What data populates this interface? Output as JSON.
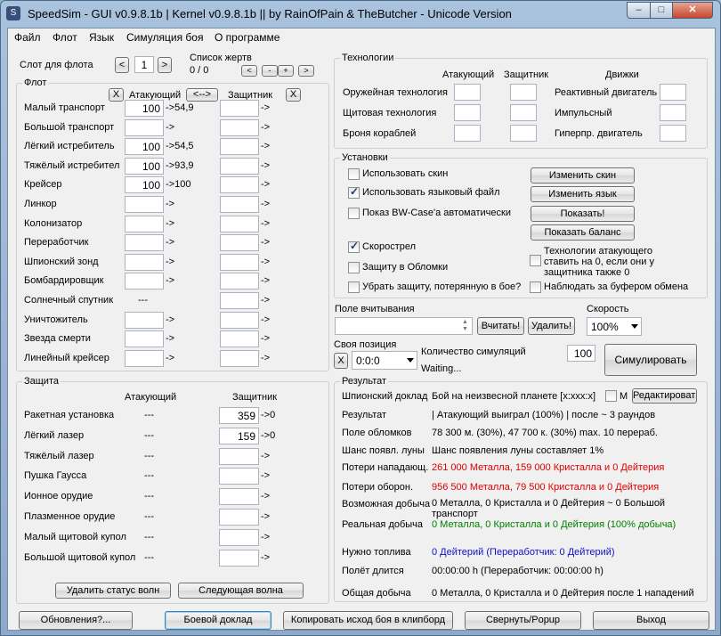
{
  "window": {
    "title": "SpeedSim - GUI v0.9.8.1b | Kernel v0.9.8.1b  ||  by RainOfPain & TheButcher - Unicode Version",
    "min": "‒",
    "max": "□",
    "close": "✕"
  },
  "menu": [
    "Файл",
    "Флот",
    "Язык",
    "Симуляция боя",
    "О программе"
  ],
  "slot": {
    "label": "Слот для флота",
    "value": "1",
    "prev": "<",
    "next": ">"
  },
  "victims": {
    "label": "Список жертв",
    "count": "0 / 0",
    "b1": "<",
    "b2": "-",
    "b3": "+",
    "b4": ">"
  },
  "fleet": {
    "legend": "Флот",
    "attacker": "Атакующий",
    "defender": "Защитник",
    "swap": "<-->",
    "clear": "X",
    "rows": [
      {
        "name": "Малый транспорт",
        "att": "100",
        "loss": "->54,9",
        "def": "",
        "dloss": "->"
      },
      {
        "name": "Большой транспорт",
        "att": "",
        "loss": "->",
        "def": "",
        "dloss": "->"
      },
      {
        "name": "Лёгкий истребитель",
        "att": "100",
        "loss": "->54,5",
        "def": "",
        "dloss": "->"
      },
      {
        "name": "Тяжёлый истребител",
        "att": "100",
        "loss": "->93,9",
        "def": "",
        "dloss": "->"
      },
      {
        "name": "Крейсер",
        "att": "100",
        "loss": "->100",
        "def": "",
        "dloss": "->"
      },
      {
        "name": "Линкор",
        "att": "",
        "loss": "->",
        "def": "",
        "dloss": "->"
      },
      {
        "name": "Колонизатор",
        "att": "",
        "loss": "->",
        "def": "",
        "dloss": "->"
      },
      {
        "name": "Переработчик",
        "att": "",
        "loss": "->",
        "def": "",
        "dloss": "->"
      },
      {
        "name": "Шпионский зонд",
        "att": "",
        "loss": "->",
        "def": "",
        "dloss": "->"
      },
      {
        "name": "Бомбардировщик",
        "att": "",
        "loss": "->",
        "def": "",
        "dloss": "->"
      },
      {
        "name": "Солнечный спутник",
        "att": "---",
        "loss": "",
        "def": "",
        "dloss": "->"
      },
      {
        "name": "Уничтожитель",
        "att": "",
        "loss": "->",
        "def": "",
        "dloss": "->"
      },
      {
        "name": "Звезда смерти",
        "att": "",
        "loss": "->",
        "def": "",
        "dloss": "->"
      },
      {
        "name": "Линейный крейсер",
        "att": "",
        "loss": "->",
        "def": "",
        "dloss": "->"
      }
    ]
  },
  "defense": {
    "legend": "Защита",
    "attacker": "Атакующий",
    "defender": "Защитник",
    "rows": [
      {
        "name": "Ракетная установка",
        "att": "---",
        "def": "359",
        "dloss": "->0"
      },
      {
        "name": "Лёгкий лазер",
        "att": "---",
        "def": "159",
        "dloss": "->0"
      },
      {
        "name": "Тяжёлый лазер",
        "att": "---",
        "def": "",
        "dloss": "->"
      },
      {
        "name": "Пушка Гаусса",
        "att": "---",
        "def": "",
        "dloss": "->"
      },
      {
        "name": "Ионное орудие",
        "att": "---",
        "def": "",
        "dloss": "->"
      },
      {
        "name": "Плазменное орудие",
        "att": "---",
        "def": "",
        "dloss": "->"
      },
      {
        "name": "Малый щитовой купол",
        "att": "---",
        "def": "",
        "dloss": "->"
      },
      {
        "name": "Большой щитовой купол",
        "att": "---",
        "def": "",
        "dloss": "->"
      }
    ],
    "del_wave": "Удалить статус волн",
    "next_wave": "Следующая волна"
  },
  "tech": {
    "legend": "Технологии",
    "attacker": "Атакующий",
    "defender": "Защитник",
    "engines": "Движки",
    "rows": [
      "Оружейная технология",
      "Щитовая технология",
      "Броня кораблей"
    ],
    "engrows": [
      "Реактивный двигатель",
      "Импульсный",
      "Гиперпр. двигатель"
    ]
  },
  "settings": {
    "legend": "Установки",
    "use_skin": "Использовать скин",
    "use_lang": "Использовать языковый файл",
    "show_bw": "Показ BW-Case'а  автоматически",
    "rapid": "Скорострел",
    "debris_def": "Защиту в Обломки",
    "remove_def": "Убрать защиту, потерянную в бое?",
    "att_tech_zero": "Технологии атакующего ставить на 0, если они у защитника также 0",
    "clipboard": "Наблюдать за буфером обмена",
    "change_skin": "Изменить скин",
    "change_lang": "Изменить язык",
    "show": "Показать!",
    "show_balance": "Показать баланс"
  },
  "readin": {
    "label": "Поле вчитывания",
    "read": "Вчитать!",
    "delete": "Удалить!"
  },
  "speed": {
    "label": "Скорость",
    "value": "100%"
  },
  "own": {
    "label": "Своя позиция",
    "value": "0:0:0",
    "x": "X"
  },
  "sim": {
    "count_label": "Количество симуляций",
    "count": "100",
    "status": "Waiting...",
    "button": "Симулировать"
  },
  "result": {
    "legend": "Результат",
    "spy_label": "Шпионский доклад",
    "spy_value": "Бой на неизвесной планете [x:xxx:x]",
    "m": "M",
    "edit": "Редактировать",
    "res_label": "Результат",
    "res_value": "| Атакующий выиграл (100%) | после ~ 3 раундов",
    "debris_label": "Поле обломков",
    "debris_value": "78 300 м. (30%), 47 700 к. (30%) max. 10 перераб.",
    "moon_label": "Шанс появл. луны",
    "moon_value": "Шанс появления луны составляет 1%",
    "attloss_label": "Потери нападающ.",
    "attloss_value": "261 000 Металла, 159 000 Кристалла и 0 Дейтерия",
    "defloss_label": "Потери оборон.",
    "defloss_value": "956 500 Металла, 79 500 Кристалла и 0 Дейтерия",
    "poss_label": "Возможная добыча",
    "poss_value": "0 Металла, 0 Кристалла и 0 Дейтерия ~ 0 Большой транспорт",
    "real_label": "Реальная добыча",
    "real_value": "0 Металла, 0 Кристалла и 0 Дейтерия (100% добыча)",
    "fuel_label": "Нужно топлива",
    "fuel_value": "0 Дейтерий (Переработчик: 0 Дейтерий)",
    "flight_label": "Полёт длится",
    "flight_value": "00:00:00 h (Переработчик: 00:00:00 h)",
    "total_label": "Общая добыча",
    "total_value": "0 Металла, 0 Кристалла и 0 Дейтерия после 1 нападений"
  },
  "bottom": {
    "updates": "Обновления?...",
    "report": "Боевой доклад",
    "copy": "Копировать исход боя в клипборд",
    "popup": "Свернуть/Popup",
    "exit": "Выход"
  }
}
